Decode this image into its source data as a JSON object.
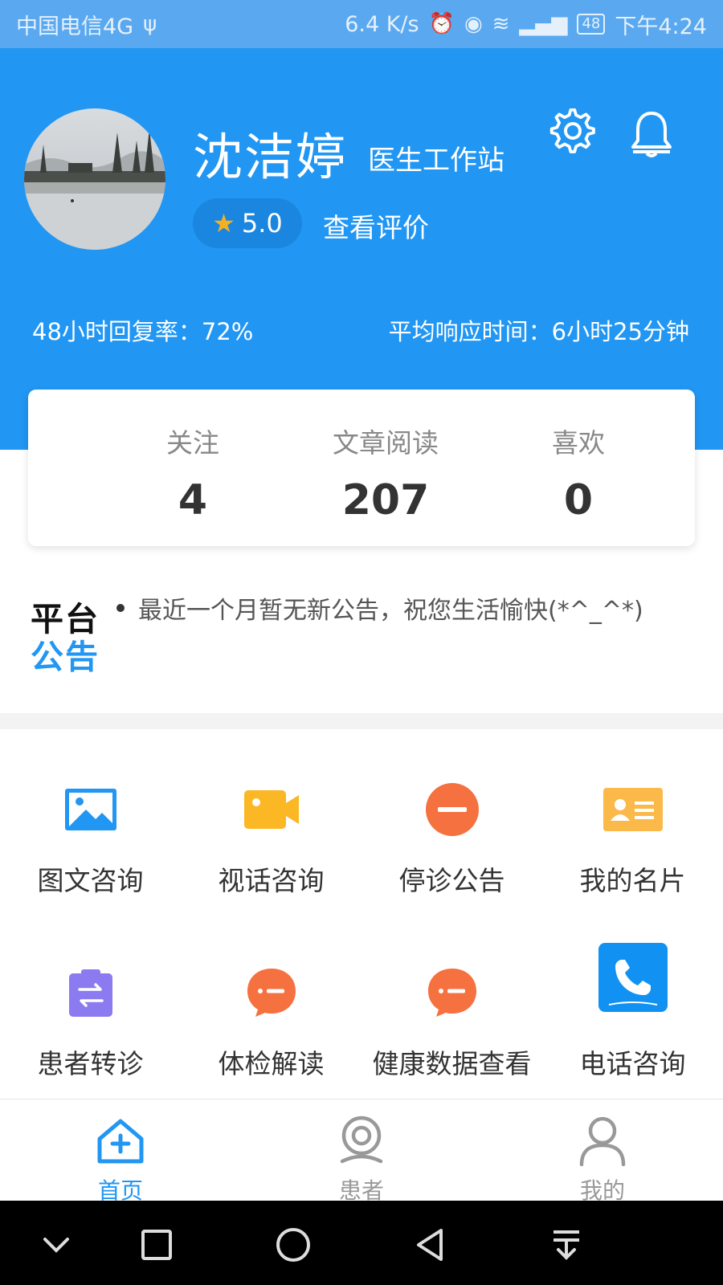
{
  "status_bar": {
    "carrier": "中国电信4G",
    "speed": "6.4 K/s",
    "battery": "48",
    "time": "下午4:24"
  },
  "header": {
    "doctor_name": "沈洁婷",
    "workstation": "医生工作站",
    "rating": "5.0",
    "view_reviews": "查看评价",
    "reply_rate": "48小时回复率：72%",
    "avg_response": "平均响应时间：6小时25分钟",
    "accent_color": "#2196f3"
  },
  "stats": [
    {
      "label": "关注",
      "value": "4"
    },
    {
      "label": "文章阅读",
      "value": "207"
    },
    {
      "label": "喜欢",
      "value": "0"
    }
  ],
  "notice": {
    "logo_line1": "平台",
    "logo_line2": "公告",
    "text": "最近一个月暂无新公告，祝您生活愉快(*^_^*)"
  },
  "services": [
    {
      "label": "图文咨询",
      "icon": "image-icon",
      "color": "#2196f3"
    },
    {
      "label": "视话咨询",
      "icon": "video-camera-icon",
      "color": "#fbb724"
    },
    {
      "label": "停诊公告",
      "icon": "stop-circle-icon",
      "color": "#f57140"
    },
    {
      "label": "我的名片",
      "icon": "business-card-icon",
      "color": "#fbb94a"
    },
    {
      "label": "患者转诊",
      "icon": "transfer-clipboard-icon",
      "color": "#8c7af0"
    },
    {
      "label": "体检解读",
      "icon": "chat-bubble-icon",
      "color": "#f57140"
    },
    {
      "label": "健康数据查看",
      "icon": "chat-bubble-icon",
      "color": "#f57140"
    },
    {
      "label": "电话咨询",
      "icon": "phone-icon",
      "color": "#1192f2"
    }
  ],
  "tabs": [
    {
      "label": "首页",
      "icon": "home-plus-icon",
      "active": true
    },
    {
      "label": "患者",
      "icon": "patient-icon",
      "active": false
    },
    {
      "label": "我的",
      "icon": "profile-icon",
      "active": false
    }
  ]
}
